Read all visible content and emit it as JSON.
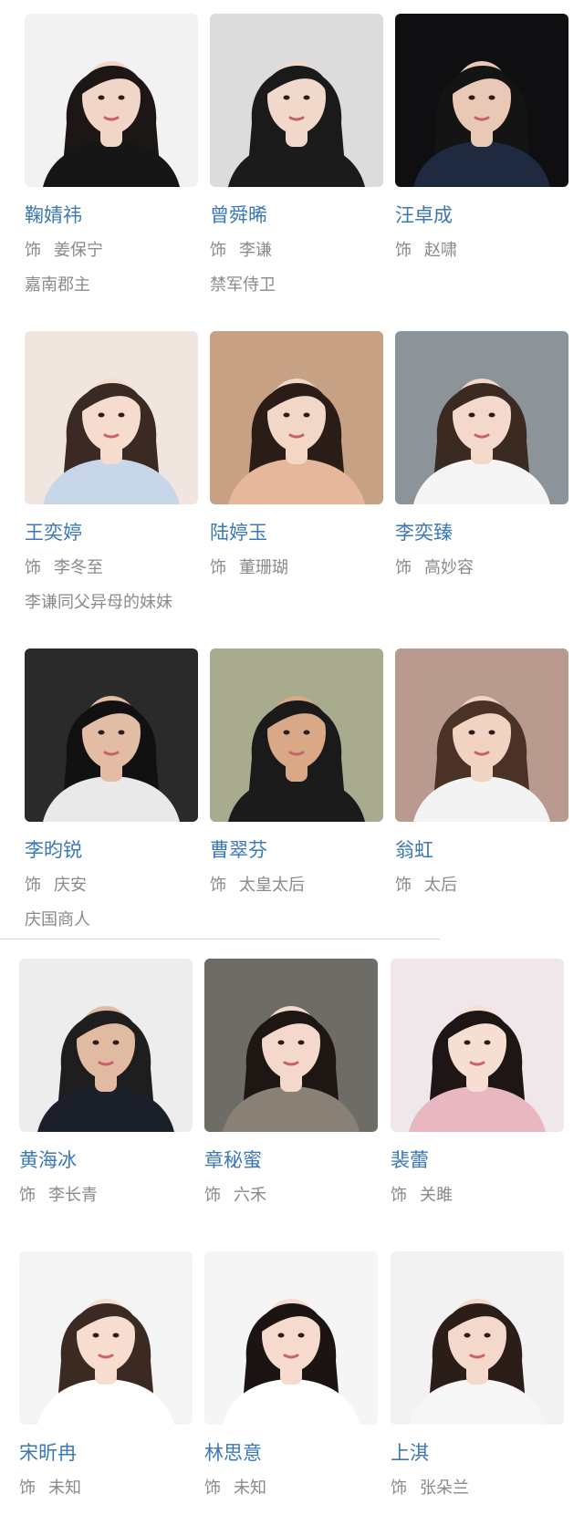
{
  "role_prefix": "饰",
  "cast": [
    {
      "name": "鞠婧祎",
      "role": "姜保宁",
      "desc": "嘉南郡主",
      "photo": {
        "bg": "#f2f2f2",
        "hair": "#1c1614",
        "skin": "#f1d6c8",
        "cloth": "#161616"
      }
    },
    {
      "name": "曾舜晞",
      "role": "李谦",
      "desc": "禁军侍卫",
      "photo": {
        "bg": "#dcdcdc",
        "hair": "#1a1a1a",
        "skin": "#f0d9cb",
        "cloth": "#1b1b1b"
      }
    },
    {
      "name": "汪卓成",
      "role": "赵啸",
      "desc": "",
      "photo": {
        "bg": "#0f0f12",
        "hair": "#141414",
        "skin": "#e9c8b6",
        "cloth": "#1f2a40"
      }
    },
    {
      "name": "王奕婷",
      "role": "李冬至",
      "desc": "李谦同父异母的妹妹",
      "photo": {
        "bg": "#f1e6df",
        "hair": "#3a2a23",
        "skin": "#f5dccf",
        "cloth": "#c8d6ea"
      }
    },
    {
      "name": "陆婷玉",
      "role": "董珊瑚",
      "desc": "",
      "photo": {
        "bg": "#c7a184",
        "hair": "#2a1d18",
        "skin": "#f2d6c6",
        "cloth": "#e6b79a"
      }
    },
    {
      "name": "李奕臻",
      "role": "高妙容",
      "desc": "",
      "photo": {
        "bg": "#8d9499",
        "hair": "#3b2a22",
        "skin": "#f3d8cb",
        "cloth": "#f5f5f5"
      }
    },
    {
      "name": "李昀锐",
      "role": "庆安",
      "desc": "庆国商人",
      "photo": {
        "bg": "#2b2a2a",
        "hair": "#111111",
        "skin": "#e3bca5",
        "cloth": "#e9e9e9"
      }
    },
    {
      "name": "曹翠芬",
      "role": "太皇太后",
      "desc": "",
      "photo": {
        "bg": "#a9ab8e",
        "hair": "#1a1a1a",
        "skin": "#d9a886",
        "cloth": "#1b1b1b"
      }
    },
    {
      "name": "翁虹",
      "role": "太后",
      "desc": "",
      "photo": {
        "bg": "#b99a8e",
        "hair": "#4a3326",
        "skin": "#f1d3c2",
        "cloth": "#f3f3f3"
      }
    },
    {
      "name": "黄海冰",
      "role": "李长青",
      "desc": "",
      "photo": {
        "bg": "#ededed",
        "hair": "#1e1e1e",
        "skin": "#e0bba2",
        "cloth": "#1a1f2a"
      }
    },
    {
      "name": "章秘蜜",
      "role": "六禾",
      "desc": "",
      "photo": {
        "bg": "#6d6c67",
        "hair": "#1e1612",
        "skin": "#f3d8cb",
        "cloth": "#8a8176"
      }
    },
    {
      "name": "裴蕾",
      "role": "关雎",
      "desc": "",
      "photo": {
        "bg": "#efe7ea",
        "hair": "#1d1614",
        "skin": "#f6ded2",
        "cloth": "#e9b7bf"
      }
    },
    {
      "name": "宋昕冉",
      "role": "未知",
      "desc": "",
      "photo": {
        "bg": "#f4f4f4",
        "hair": "#3a2a22",
        "skin": "#f7ddd0",
        "cloth": "#ffffff"
      }
    },
    {
      "name": "林思意",
      "role": "未知",
      "desc": "",
      "photo": {
        "bg": "#f5f5f5",
        "hair": "#1b1413",
        "skin": "#f6dacd",
        "cloth": "#ffffff"
      }
    },
    {
      "name": "上淇",
      "role": "张朵兰",
      "desc": "",
      "photo": {
        "bg": "#f2f2f2",
        "hair": "#2b1d18",
        "skin": "#f4d8cb",
        "cloth": "#f6f6f6"
      }
    }
  ]
}
